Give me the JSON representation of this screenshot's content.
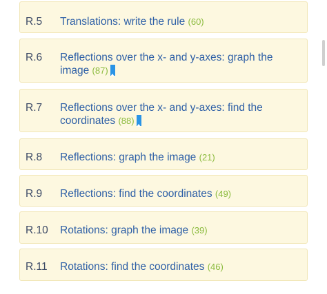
{
  "skills": [
    {
      "code": "R.5",
      "title": "Translations: write the rule",
      "count": "(60)",
      "bookmarked": false
    },
    {
      "code": "R.6",
      "title": "Reflections over the x- and y-axes: graph the image",
      "count": "(87)",
      "bookmarked": true
    },
    {
      "code": "R.7",
      "title": "Reflections over the x- and y-axes: find the coordinates",
      "count": "(88)",
      "bookmarked": true
    },
    {
      "code": "R.8",
      "title": "Reflections: graph the image",
      "count": "(21)",
      "bookmarked": false
    },
    {
      "code": "R.9",
      "title": "Reflections: find the coordinates",
      "count": "(49)",
      "bookmarked": false
    },
    {
      "code": "R.10",
      "title": "Rotations: graph the image",
      "count": "(39)",
      "bookmarked": false
    },
    {
      "code": "R.11",
      "title": "Rotations: find the coordinates",
      "count": "(46)",
      "bookmarked": false
    }
  ],
  "icons": {
    "bookmark": "bookmark-icon"
  },
  "colors": {
    "row_background": "#fdf8e0",
    "code_text": "#3c4a66",
    "title_text": "#2d5fa6",
    "count_text": "#8aba3c",
    "bookmark": "#2a94e6"
  }
}
